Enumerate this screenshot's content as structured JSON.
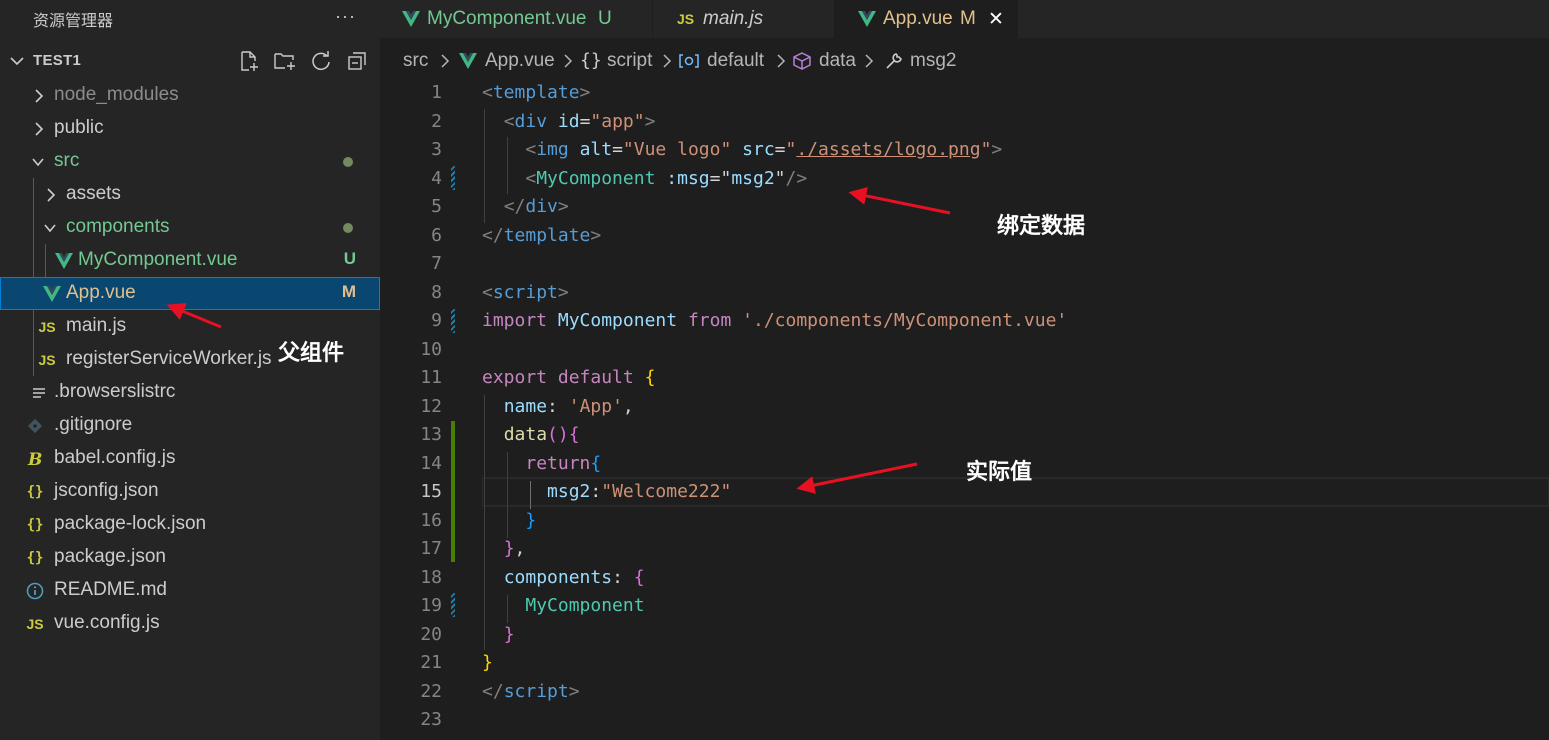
{
  "explorer": {
    "title": "资源管理器",
    "more": "···",
    "section": "TEST1",
    "items": [
      {
        "label": "node_modules",
        "kind": "folder",
        "status": ""
      },
      {
        "label": "public",
        "kind": "folder",
        "status": ""
      },
      {
        "label": "src",
        "kind": "folder",
        "status": "dot"
      },
      {
        "label": "assets",
        "kind": "folder",
        "status": ""
      },
      {
        "label": "components",
        "kind": "folder",
        "status": "dot"
      },
      {
        "label": "MyComponent.vue",
        "kind": "vue",
        "status": "U"
      },
      {
        "label": "App.vue",
        "kind": "vue",
        "status": "M"
      },
      {
        "label": "main.js",
        "kind": "js",
        "status": ""
      },
      {
        "label": "registerServiceWorker.js",
        "kind": "js",
        "status": ""
      },
      {
        "label": ".browserslistrc",
        "kind": "list",
        "status": ""
      },
      {
        "label": ".gitignore",
        "kind": "git",
        "status": ""
      },
      {
        "label": "babel.config.js",
        "kind": "babel",
        "status": ""
      },
      {
        "label": "jsconfig.json",
        "kind": "json",
        "status": ""
      },
      {
        "label": "package-lock.json",
        "kind": "json",
        "status": ""
      },
      {
        "label": "package.json",
        "kind": "json",
        "status": ""
      },
      {
        "label": "README.md",
        "kind": "info",
        "status": ""
      },
      {
        "label": "vue.config.js",
        "kind": "js",
        "status": ""
      }
    ]
  },
  "tabs": [
    {
      "label": "MyComponent.vue",
      "status": "U"
    },
    {
      "label": "main.js",
      "status": ""
    },
    {
      "label": "App.vue",
      "status": "M",
      "close": "✕"
    }
  ],
  "js_icon_text": "JS",
  "json_icon_text": "{}",
  "breadcrumb": {
    "src": "src",
    "file": "App.vue",
    "script_icon": "{}",
    "script": "script",
    "default": "default",
    "data": "data",
    "msg2": "msg2"
  },
  "line_numbers": [
    "1",
    "2",
    "3",
    "4",
    "5",
    "6",
    "7",
    "8",
    "9",
    "10",
    "11",
    "12",
    "13",
    "14",
    "15",
    "16",
    "17",
    "18",
    "19",
    "20",
    "21",
    "22",
    "23"
  ],
  "code": {
    "l1_open": "<",
    "l1_tag": "template",
    "l1_close": ">",
    "l2_open": "<",
    "l2_tag": "div",
    "l2_attr": "id",
    "l2_eq": "=",
    "l2_val": "\"app\"",
    "l2_close": ">",
    "l3_open": "<",
    "l3_tag": "img",
    "l3_attr1": "alt",
    "l3_eq1": "=",
    "l3_val1": "\"Vue logo\"",
    "l3_attr2": "src",
    "l3_eq2": "=",
    "l3_q1": "\"",
    "l3_path": "./assets/logo.png",
    "l3_q2": "\"",
    "l3_close": ">",
    "l4_open": "<",
    "l4_comp": "MyComponent",
    "l4_attr": ":msg",
    "l4_eq": "=",
    "l4_q1": "\"",
    "l4_val": "msg2",
    "l4_q2": "\"",
    "l4_close": "/>",
    "l5_open": "</",
    "l5_tag": "div",
    "l5_close": ">",
    "l6_open": "</",
    "l6_tag": "template",
    "l6_close": ">",
    "l8_open": "<",
    "l8_tag": "script",
    "l8_close": ">",
    "l9_import": "import",
    "l9_name": "MyComponent",
    "l9_from": "from",
    "l9_str": "'./components/MyComponent.vue'",
    "l11_export": "export",
    "l11_default": "default",
    "l11_brace": "{",
    "l12_key": "name",
    "l12_colon": ": ",
    "l12_str": "'App'",
    "l12_comma": ",",
    "l13_fn": "data",
    "l13_paren": "()",
    "l13_brace": "{",
    "l14_ret": "return",
    "l14_brace": "{",
    "l15_key": "msg2",
    "l15_colon": ":",
    "l15_str": "\"Welcome222\"",
    "l16_brace": "}",
    "l17_brace": "}",
    "l17_comma": ",",
    "l18_key": "components",
    "l18_colon": ": ",
    "l18_brace": "{",
    "l19_comp": "MyComponent",
    "l20_brace": "}",
    "l21_brace": "}",
    "l22_open": "</",
    "l22_tag": "script",
    "l22_close": ">"
  },
  "annotations": {
    "bind": "绑定数据",
    "parent": "父组件",
    "actual": "实际值"
  },
  "colors": {
    "accent_selection": "#094771",
    "vue_green": "#41b883",
    "untracked": "#73c991",
    "modified": "#e2c08d",
    "arrow": "#e81123"
  }
}
